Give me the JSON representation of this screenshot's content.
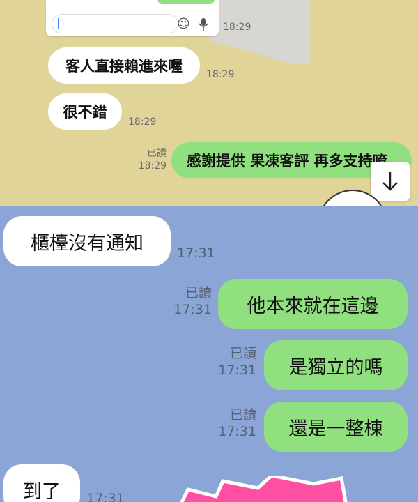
{
  "top_chat": {
    "embedded_input_time": "18:29",
    "messages": [
      {
        "text": "客人直接賴進來喔",
        "time": "18:29"
      },
      {
        "text": "很不錯",
        "time": "18:29"
      },
      {
        "text": "感謝提供 果凍客評 再多支持唷",
        "read": "已讀",
        "time": "18:29"
      }
    ],
    "scroll_down_icon": "arrow-down-icon"
  },
  "bottom_chat": {
    "messages": [
      {
        "text": "櫃檯沒有通知",
        "time": "17:31"
      },
      {
        "text": "他本來就在這邊",
        "read": "已讀",
        "time": "17:31"
      },
      {
        "text": "是獨立的嗎",
        "read": "已讀",
        "time": "17:31"
      },
      {
        "text": "還是一整棟",
        "read": "已讀",
        "time": "17:31"
      },
      {
        "text": "到了",
        "time": "17:31"
      }
    ]
  },
  "colors": {
    "top_bg": "#e1d498",
    "bottom_bg": "#8ba6d6",
    "outgoing_bubble": "#90e07f",
    "incoming_bubble": "#ffffff",
    "watermark_pink": "#ff4fa3"
  }
}
